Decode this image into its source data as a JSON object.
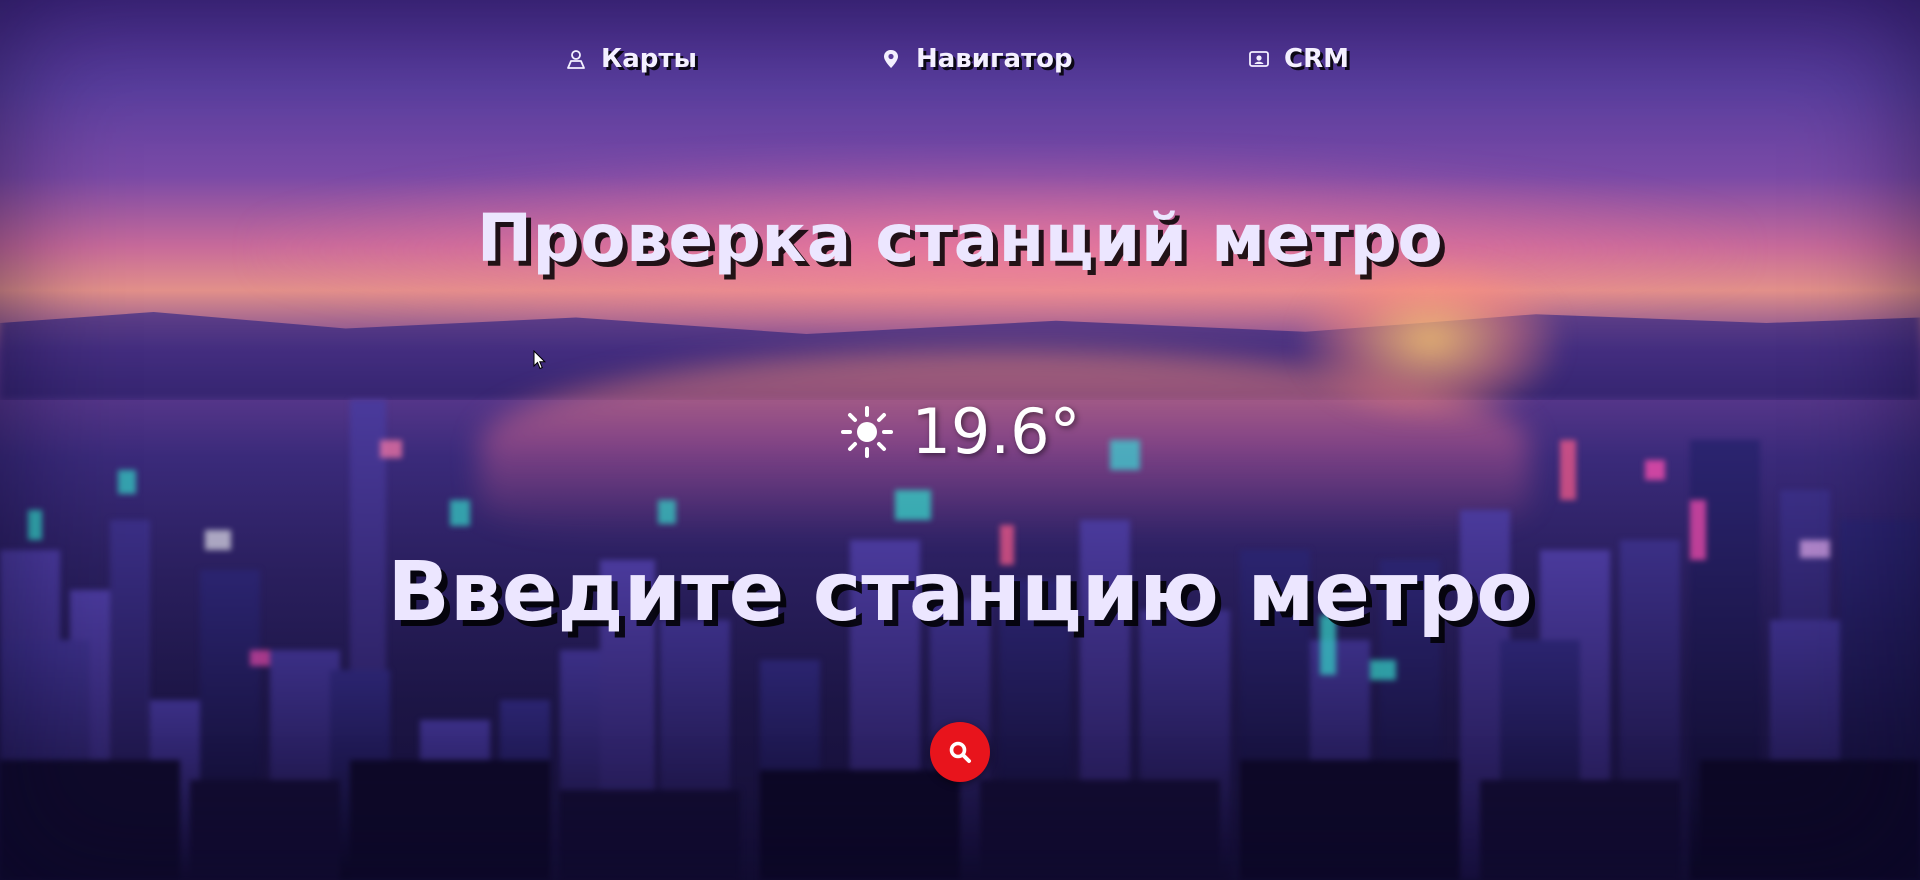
{
  "nav": {
    "items": [
      {
        "label": "Карты",
        "icon": "person-pin-icon"
      },
      {
        "label": "Навигатор",
        "icon": "map-marker-icon"
      },
      {
        "label": "CRM",
        "icon": "contact-card-icon"
      }
    ]
  },
  "main": {
    "title": "Проверка станций метро",
    "weather": {
      "icon": "sun-icon",
      "temperature": "19.6°"
    },
    "prompt": "Введите станцию метро",
    "search_icon": "search-icon"
  },
  "colors": {
    "accent": "#e8141c",
    "text": "#ece6ff",
    "text_shadow": "#000000"
  }
}
